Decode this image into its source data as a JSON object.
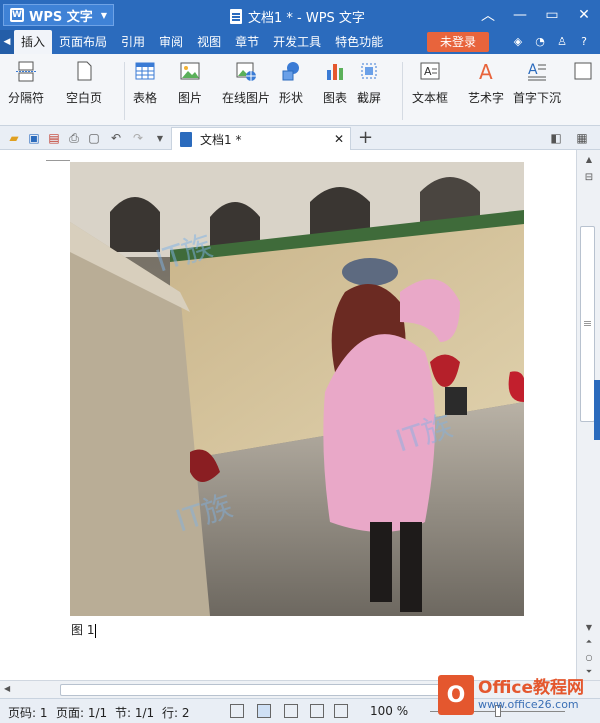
{
  "titlebar": {
    "app_name": "WPS 文字",
    "doc_title": "文档1 * - WPS 文字"
  },
  "menu": {
    "tabs": [
      "插入",
      "页面布局",
      "引用",
      "审阅",
      "视图",
      "章节",
      "开发工具",
      "特色功能"
    ],
    "active": "插入",
    "login": "未登录"
  },
  "ribbon": {
    "items": [
      {
        "label": "分隔符",
        "icon": "page-break-icon"
      },
      {
        "label": "空白页",
        "icon": "blank-page-icon"
      },
      {
        "label": "表格",
        "icon": "table-icon"
      },
      {
        "label": "图片",
        "icon": "picture-icon"
      },
      {
        "label": "在线图片",
        "icon": "online-picture-icon"
      },
      {
        "label": "形状",
        "icon": "shapes-icon"
      },
      {
        "label": "图表",
        "icon": "chart-icon"
      },
      {
        "label": "截屏",
        "icon": "screenshot-icon"
      },
      {
        "label": "文本框",
        "icon": "textbox-icon"
      },
      {
        "label": "艺术字",
        "icon": "wordart-icon"
      },
      {
        "label": "首字下沉",
        "icon": "dropcap-icon"
      }
    ]
  },
  "doc_tab": {
    "title": "文档1 *"
  },
  "document": {
    "caption": "图 1"
  },
  "status": {
    "page_code": "页码: 1",
    "page": "页面: 1/1",
    "section": "节: 1/1",
    "row": "行: 2",
    "zoom": "100 %"
  },
  "watermark": {
    "title": "Office教程网",
    "url": "www.office26.com"
  },
  "colors": {
    "title_blue": "#2b6bbd",
    "login_orange": "#e8643c"
  }
}
